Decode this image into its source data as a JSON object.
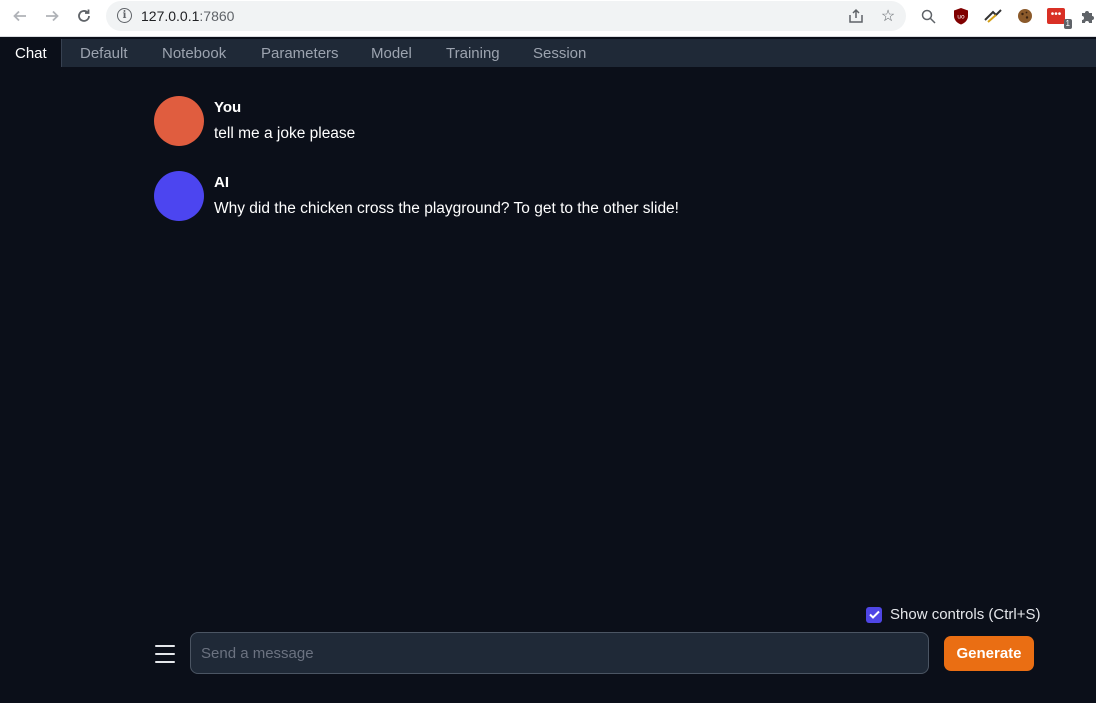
{
  "browser": {
    "url_host": "127.0.0.1",
    "url_port": ":7860",
    "extension_badge": "1"
  },
  "tabs": [
    {
      "label": "Chat"
    },
    {
      "label": "Default"
    },
    {
      "label": "Notebook"
    },
    {
      "label": "Parameters"
    },
    {
      "label": "Model"
    },
    {
      "label": "Training"
    },
    {
      "label": "Session"
    }
  ],
  "active_tab": "Chat",
  "messages": [
    {
      "sender": "You",
      "text": "tell me a joke please",
      "avatar_color": "#e05d3f"
    },
    {
      "sender": "AI",
      "text": "Why did the chicken cross the playground? To get to the other slide!",
      "avatar_color": "#4c45f0"
    }
  ],
  "controls": {
    "show_controls_label": "Show controls (Ctrl+S)",
    "show_controls_checked": true,
    "input_placeholder": "Send a message",
    "input_value": "",
    "generate_label": "Generate"
  },
  "colors": {
    "background": "#0b0f19",
    "tabbar": "#1f2937",
    "accent": "#ea6e13",
    "checkbox": "#4f46e5"
  }
}
